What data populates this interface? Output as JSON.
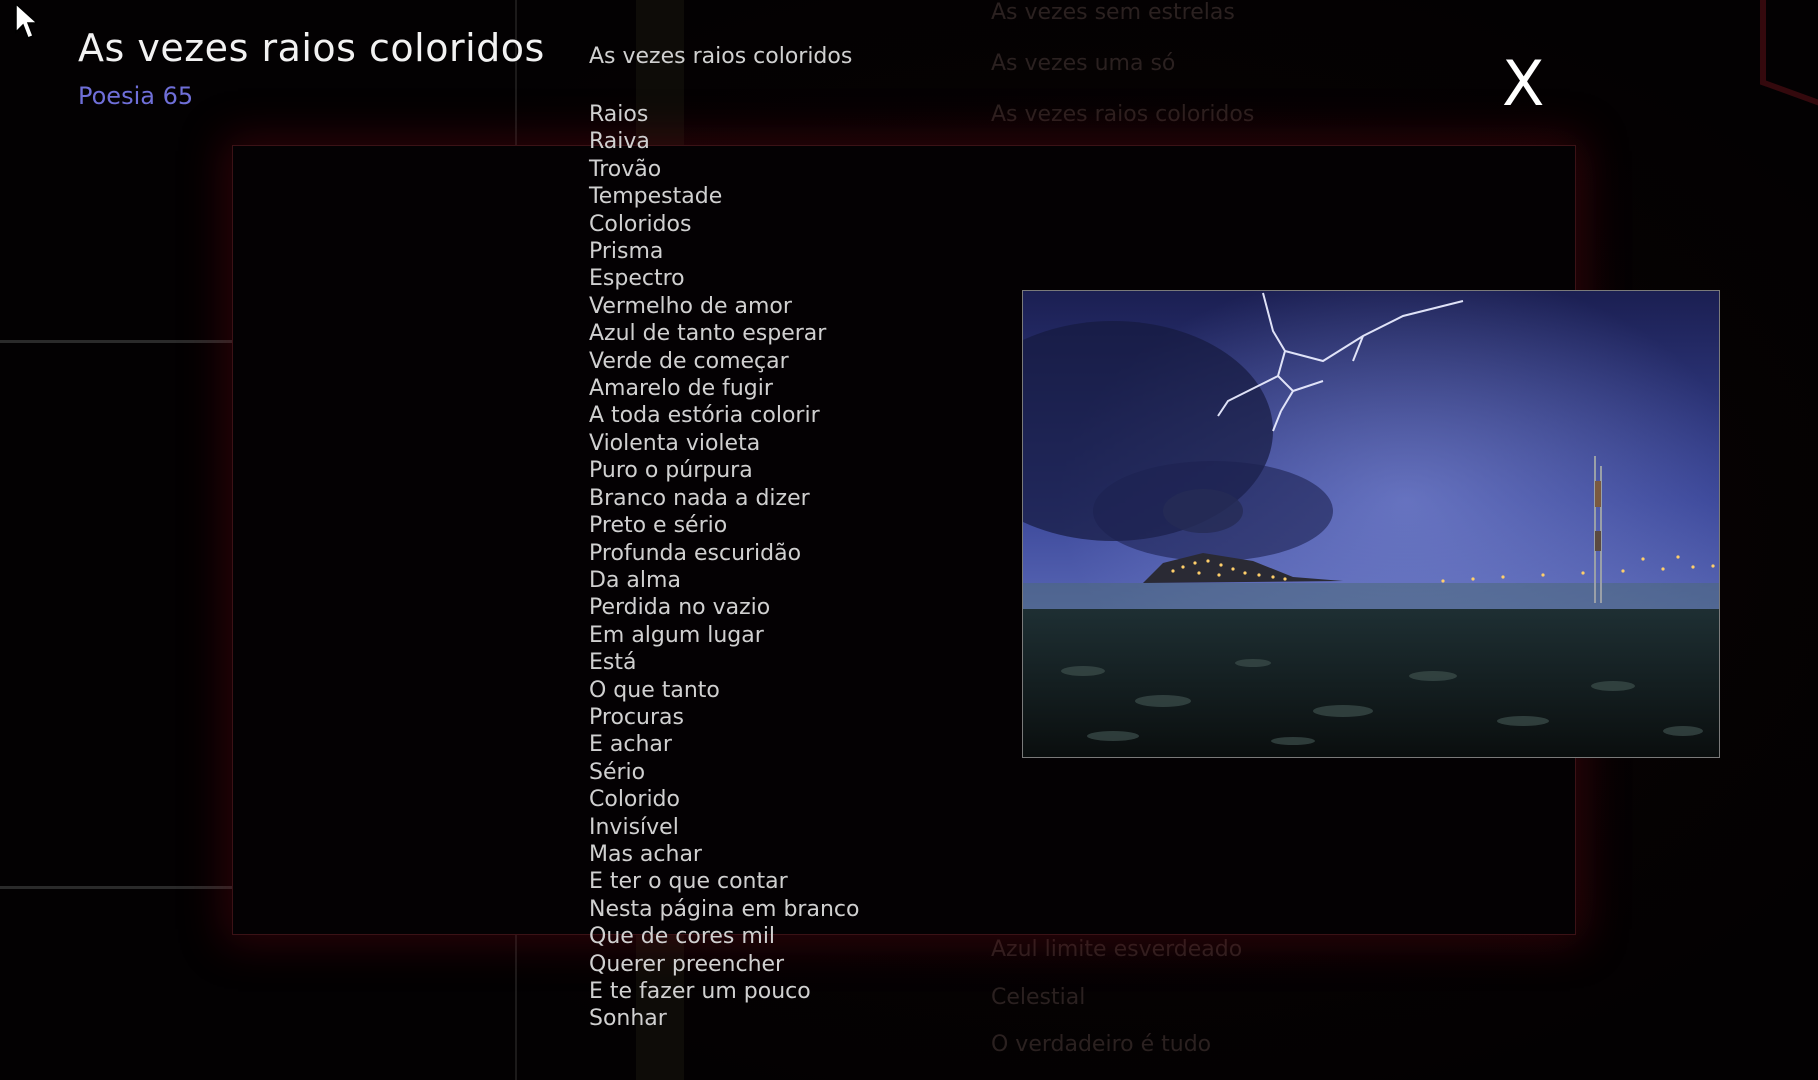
{
  "header": {
    "title": "As vezes raios coloridos",
    "subtitle": "Poesia 65"
  },
  "close_button": {
    "label": "X"
  },
  "poem": {
    "title": "As vezes raios coloridos",
    "lines": [
      "Raios",
      "Raiva",
      "Trovão",
      "Tempestade",
      "Coloridos",
      "Prisma",
      "Espectro",
      "Vermelho de amor",
      "Azul de tanto esperar",
      "Verde de começar",
      "Amarelo de fugir",
      "A toda estória colorir",
      "Violenta violeta",
      "Puro o púrpura",
      "Branco nada a dizer",
      "Preto e sério",
      "Profunda escuridão",
      "Da alma",
      "Perdida no vazio",
      "Em algum lugar",
      "Está",
      "O que tanto",
      "Procuras",
      "E achar",
      "Sério",
      "Colorido",
      "Invisível",
      "Mas achar",
      "E ter o que contar",
      "Nesta página em branco",
      "Que de cores mil",
      "Querer preencher",
      "E te fazer um pouco",
      "Sonhar"
    ]
  },
  "background_list": {
    "top_items": [
      "As vezes sem estrelas",
      "As vezes uma só",
      "As vezes raios coloridos"
    ],
    "bottom_items": [
      "Azul limite esverdeado",
      "Celestial",
      "O verdadeiro é tudo"
    ]
  },
  "colors": {
    "background": "#040203",
    "accent_subtitle": "#6f6fd8",
    "panel_glow": "#781014",
    "text": "#d0d0d0"
  },
  "icons": {
    "cursor": "arrow-cursor-icon",
    "close": "close-icon"
  }
}
